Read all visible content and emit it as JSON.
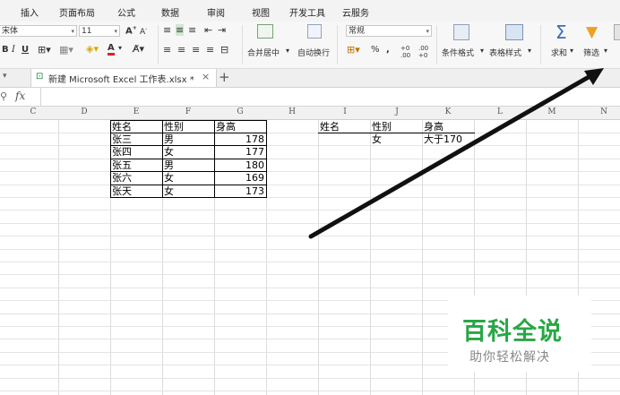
{
  "menu": [
    "插入",
    "页面布局",
    "公式",
    "数据",
    "审阅",
    "视图",
    "开发工具",
    "云服务"
  ],
  "ribbon": {
    "font_name": "宋体",
    "font_size": "11",
    "number_format": "常规",
    "merge_center": "合并居中",
    "wrap_text": "自动换行",
    "cond_format": "条件格式",
    "table_style": "表格样式",
    "sum": "求和",
    "filter": "筛选",
    "percent": "%",
    "comma": ",",
    "dec_inc": ".00 →.0",
    "dec_dec": ".00 →.0"
  },
  "tab": {
    "title": "新建 Microsoft Excel 工作表.xlsx *",
    "close": "×",
    "add": "+"
  },
  "formula": {
    "fx": "fx"
  },
  "columns": [
    "C",
    "D",
    "E",
    "F",
    "G",
    "H",
    "I",
    "J",
    "K",
    "L",
    "M",
    "N"
  ],
  "table1": {
    "headers": [
      "姓名",
      "性别",
      "身高"
    ],
    "rows": [
      {
        "name": "张三",
        "gender": "男",
        "height": "178"
      },
      {
        "name": "张四",
        "gender": "女",
        "height": "177"
      },
      {
        "name": "张五",
        "gender": "男",
        "height": "180"
      },
      {
        "name": "张六",
        "gender": "女",
        "height": "169"
      },
      {
        "name": "张天",
        "gender": "女",
        "height": "173"
      }
    ]
  },
  "criteria": {
    "headers": [
      "姓名",
      "性别",
      "身高"
    ],
    "gender": "女",
    "height": "大于170"
  },
  "watermark": {
    "title": "百科全说",
    "subtitle": "助你轻松解决"
  },
  "colors": {
    "arrow": "#111111",
    "watermark_green": "#28a745",
    "filter_icon": "#f0a020",
    "sum_icon": "#3a6fb5"
  }
}
